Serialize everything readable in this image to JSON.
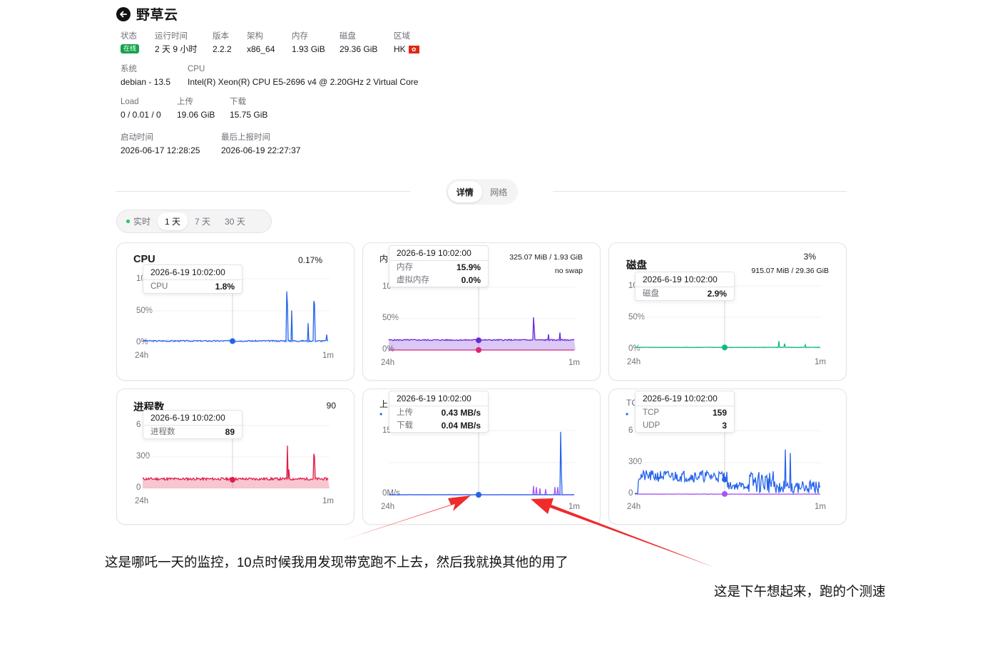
{
  "server": {
    "name": "野草云"
  },
  "info": {
    "status": {
      "label": "状态",
      "value": "在线"
    },
    "uptime": {
      "label": "运行时间",
      "value": "2 天 9 小时"
    },
    "version": {
      "label": "版本",
      "value": "2.2.2"
    },
    "arch": {
      "label": "架构",
      "value": "x86_64"
    },
    "memory": {
      "label": "内存",
      "value": "1.93 GiB"
    },
    "disk": {
      "label": "磁盘",
      "value": "29.36 GiB"
    },
    "region": {
      "label": "区域",
      "value": "HK",
      "flag_glyph": "✿"
    },
    "system": {
      "label": "系统",
      "value": "debian - 13.5"
    },
    "cpu": {
      "label": "CPU",
      "value": "Intel(R) Xeon(R) CPU E5-2696 v4 @ 2.20GHz 2 Virtual Core"
    },
    "load": {
      "label": "Load",
      "value": "0 / 0.01 / 0"
    },
    "upload": {
      "label": "上传",
      "value": "19.06 GiB"
    },
    "download": {
      "label": "下载",
      "value": "15.75 GiB"
    },
    "boot_time": {
      "label": "启动时间",
      "value": "2026-06-17 12:28:25"
    },
    "last_report": {
      "label": "最后上报时间",
      "value": "2026-06-19 22:27:37"
    }
  },
  "tabs": [
    {
      "label": "详情",
      "active": true
    },
    {
      "label": "网络",
      "active": false
    }
  ],
  "ranges": [
    {
      "label": "实时",
      "active": false
    },
    {
      "label": "1 天",
      "active": true
    },
    {
      "label": "7 天",
      "active": false
    },
    {
      "label": "30 天",
      "active": false
    }
  ],
  "cards": {
    "cpu": {
      "title": "CPU",
      "value": "0.17%",
      "yticks": [
        "10",
        "50%",
        "0%"
      ],
      "xstart": "24h",
      "xend": "1m",
      "tooltip": {
        "time": "2026-6-19 10:02:00",
        "rows": [
          {
            "k": "CPU",
            "v": "1.8%"
          }
        ]
      },
      "color": "#2563eb"
    },
    "memory": {
      "title": "内",
      "line1": "325.07 MiB / 1.93 GiB",
      "line2": "no swap",
      "yticks": [
        "10",
        "50%",
        "0%"
      ],
      "xstart": "24h",
      "xend": "1m",
      "tooltip": {
        "time": "2026-6-19 10:02:00",
        "rows": [
          {
            "k": "内存",
            "v": "15.9%"
          },
          {
            "k": "虚拟内存",
            "v": "0.0%"
          }
        ]
      },
      "color": "#6d28d9",
      "color2": "#db2777"
    },
    "disk": {
      "title": "磁盘",
      "value": "3%",
      "line1": "915.07 MiB / 29.36 GiB",
      "yticks": [
        "10",
        "50%",
        "0%"
      ],
      "xstart": "24h",
      "xend": "1m",
      "tooltip": {
        "time": "2026-6-19 10:02:00",
        "rows": [
          {
            "k": "磁盘",
            "v": "2.9%"
          }
        ]
      },
      "color": "#10b981"
    },
    "process": {
      "title": "进程数",
      "value": "90",
      "yticks": [
        "6",
        "300",
        "0"
      ],
      "xstart": "24h",
      "xend": "1m",
      "tooltip": {
        "time": "2026-6-19 10:02:00",
        "rows": [
          {
            "k": "进程数",
            "v": "89"
          }
        ]
      },
      "color": "#e11d48"
    },
    "network": {
      "title": "上",
      "legend": "•",
      "yticks": [
        "15",
        "0M/s"
      ],
      "xstart": "24h",
      "xend": "1m",
      "tooltip": {
        "time": "2026-6-19 10:02:00",
        "rows": [
          {
            "k": "上传",
            "v": "0.43 MB/s"
          },
          {
            "k": "下载",
            "v": "0.04 MB/s"
          }
        ]
      },
      "color": "#2563eb",
      "color2": "#a855f7"
    },
    "connections": {
      "title": "TC",
      "legend": "•",
      "yticks": [
        "6",
        "300",
        "0"
      ],
      "xstart": "24h",
      "xend": "1m",
      "tooltip": {
        "time": "2026-6-19 10:02:00",
        "rows": [
          {
            "k": "TCP",
            "v": "159"
          },
          {
            "k": "UDP",
            "v": "3"
          }
        ]
      },
      "color": "#2563eb",
      "color2": "#a855f7"
    }
  },
  "annotations": {
    "left": "这是哪吒一天的监控，10点时候我用发现带宽跑不上去，然后我就换其他的用了",
    "right": "这是下午想起来，跑的个测速"
  },
  "arrow_color": "#ef2b2b"
}
